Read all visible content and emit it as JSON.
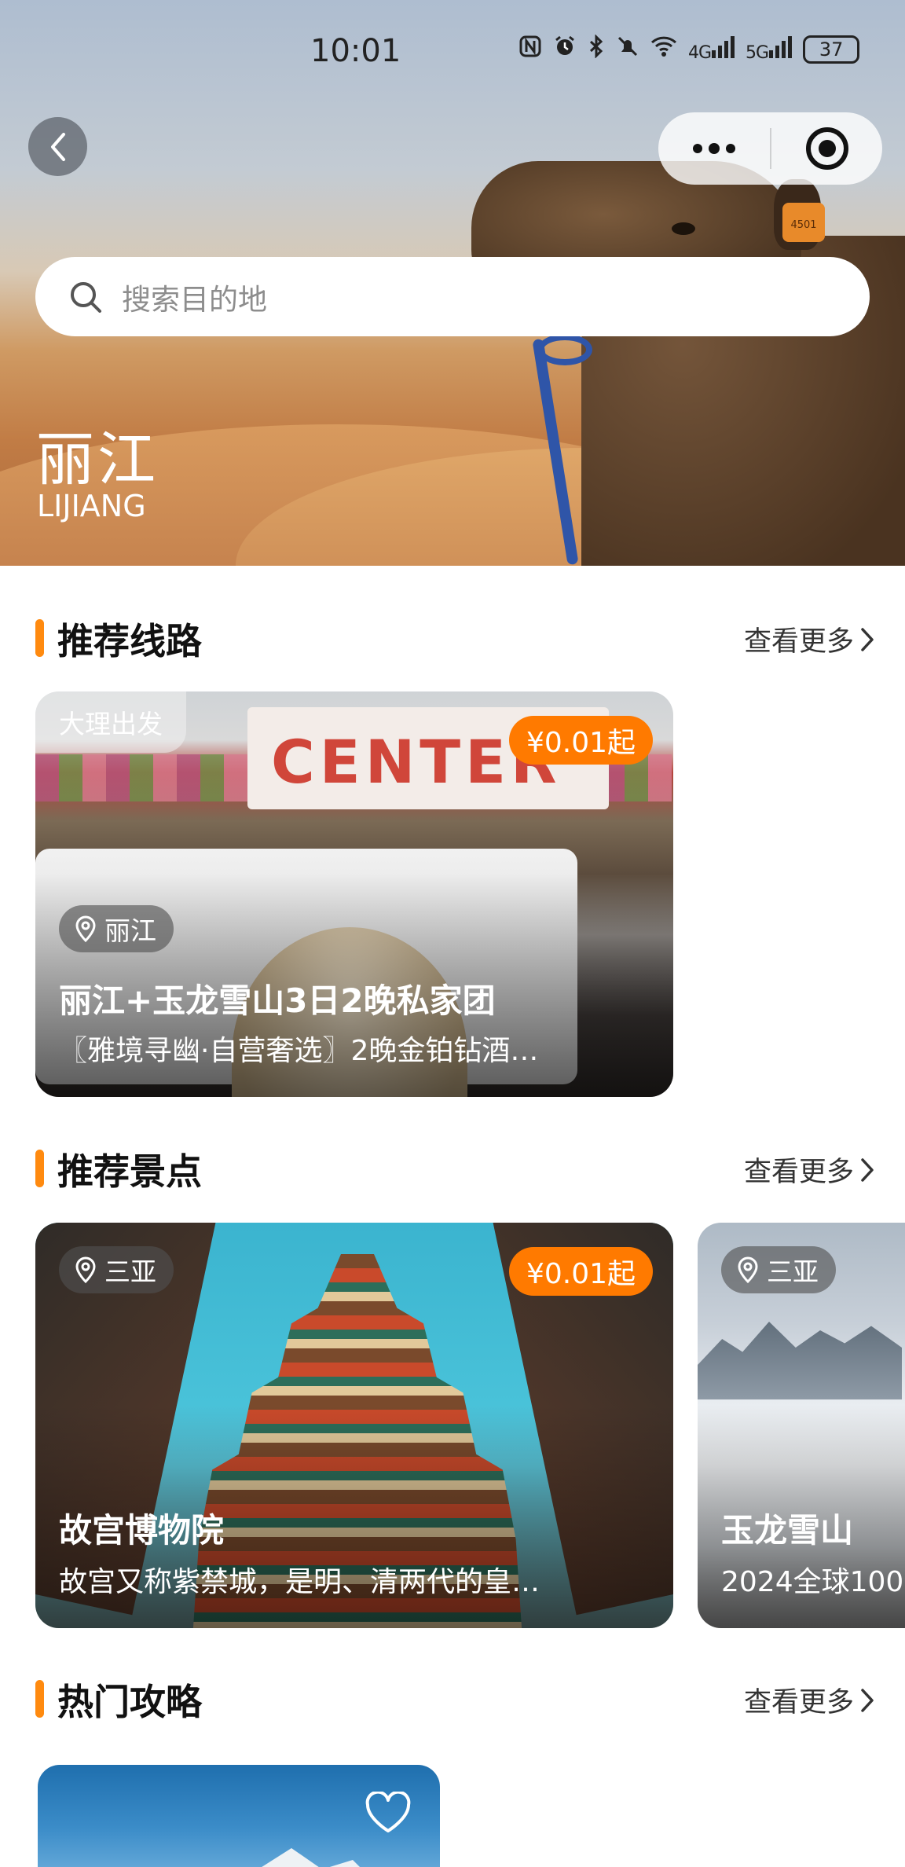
{
  "status_bar": {
    "time": "10:01",
    "icons": [
      "nfc-icon",
      "alarm-icon",
      "bluetooth-icon",
      "mute-icon",
      "wifi-icon",
      "signal-4g-icon",
      "signal-5g-icon"
    ],
    "net_4g": "4G",
    "net_5g": "5G",
    "battery": "37"
  },
  "hero": {
    "search_placeholder": "搜索目的地",
    "city_name": "丽江",
    "city_en": "LIJIANG",
    "ear_tag": "4501"
  },
  "sections": {
    "routes": {
      "title": "推荐线路",
      "more": "查看更多"
    },
    "spots": {
      "title": "推荐景点",
      "more": "查看更多"
    },
    "guides": {
      "title": "热门攻略",
      "more": "查看更多"
    }
  },
  "route_card": {
    "departure": "大理出发",
    "price": "¥0.01起",
    "location": "丽江",
    "title": "丽江+玉龙雪山3日2晚私家团",
    "subtitle": "〖雅境寻幽·自营奢选〗2晚金铂钻酒…",
    "sign_text": "CENTER"
  },
  "spot_cards": [
    {
      "location": "三亚",
      "price": "¥0.01起",
      "title": "故宫博物院",
      "subtitle": "故宫又称紫禁城，是明、清两代的皇…"
    },
    {
      "location": "三亚",
      "title": "玉龙雪山",
      "subtitle": "2024全球100"
    }
  ],
  "colors": {
    "accent": "#ff8a0f",
    "price_bg": "#ff7a00"
  }
}
